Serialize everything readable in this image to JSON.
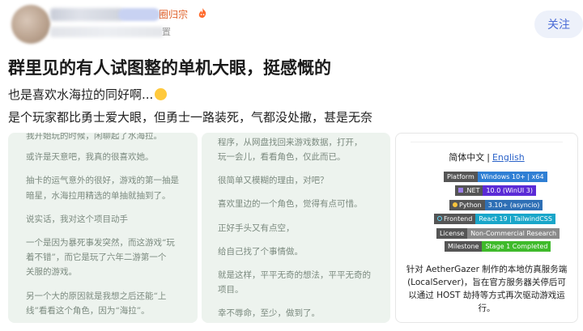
{
  "header": {
    "group_tag": "圈归宗",
    "sub_tail": "置",
    "follow_label": "关注"
  },
  "post": {
    "title": "群里见的有人试图整的单机大眼，挺感慨的",
    "line1": "也是喜欢水海拉的同好啊...",
    "line2": "是个玩家都比勇士爱大眼，但勇士一路装死，气都没处撒，甚是无奈"
  },
  "card1": {
    "lines": [
      "我开始玩的时候，闲聊起了水海拉。",
      "或许是天意吧，我真的很喜欢她。",
      "抽卡的运气意外的很好，游戏的第一抽是",
      "暗星，水海拉用精选的单抽就抽到了。",
      "说实话，我对这个项目动手",
      "一个是因为暴死事发突然，而这游戏“玩",
      "着不错”，而它是玩了六年二游第一个",
      "关服的游戏。",
      "另一个大的原因就是我想之后还能“上",
      "线”看看这个角色，因为“海拉”。"
    ]
  },
  "card2": {
    "lines": [
      "程序，从网盘找回来游戏数据，打开，",
      "玩一会儿，看看角色，仅此而已。",
      "很简单又模糊的理由，对吧？",
      "喜欢里边的一个角色，觉得有点可惜。",
      "正好手头又有点空，",
      "给自己找了个事情做。",
      "就是这样，平平无奇的想法，平平无奇的",
      "项目。",
      "幸不辱命，至少，做到了。"
    ]
  },
  "card3": {
    "lang_cn": "简体中文",
    "lang_sep": "|",
    "lang_en": "English",
    "badges": [
      {
        "key": "Platform",
        "value": "Windows 10+ | x64",
        "color": "#2f7fd4"
      },
      {
        "key": ".NET",
        "value": "10.0 (WinUI 3)",
        "color": "#5b2bd6"
      },
      {
        "key": "Python",
        "value": "3.10+ (asyncio)",
        "color": "#2e6fb5"
      },
      {
        "key": "Frontend",
        "value": "React 19 | TailwindCSS",
        "color": "#19a6c9"
      },
      {
        "key": "License",
        "value": "Non-Commercial Research",
        "color": "#8a8a8a"
      },
      {
        "key": "Milestone",
        "value": "Stage 1 Completed",
        "color": "#3fba2b"
      }
    ],
    "desc_lines": [
      "针对 AetherGazer 制作的本地仿真服务端",
      "(LocalServer)，旨在官方服务器关停后可",
      "以通过 HOST 劫持等方式再次驱动游戏运",
      "行。"
    ]
  }
}
